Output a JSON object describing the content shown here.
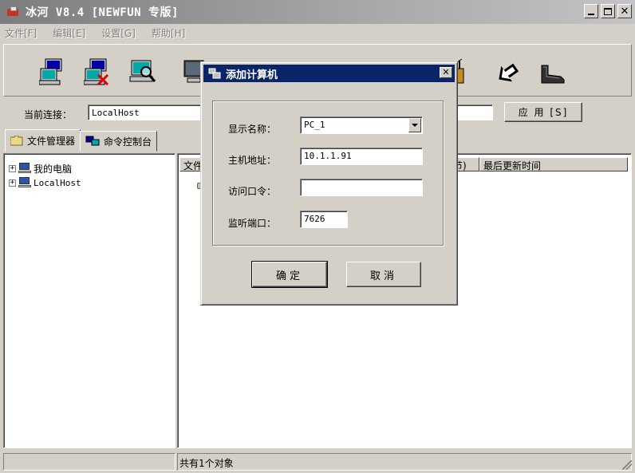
{
  "window": {
    "title": "冰河 V8.4 [NEWFUN 专版]"
  },
  "menu": [
    "文件[F]",
    "编辑[E]",
    "设置[G]",
    "帮助[H]"
  ],
  "toolbar": {
    "buttons": [
      "add-computer-icon",
      "delete-computer-icon",
      "search-computer-icon",
      "monitor-icon",
      "config-icon",
      "back-icon",
      "exit-icon"
    ]
  },
  "connection": {
    "label": "当前连接：",
    "value": "LocalHost",
    "apply_label": "应 用 [S]"
  },
  "tabs": [
    "文件管理器",
    "命令控制台"
  ],
  "tree": [
    {
      "label": "我的电脑"
    },
    {
      "label": "LocalHost"
    }
  ],
  "file_list": {
    "columns": [
      "文件",
      "节)",
      "最后更新时间"
    ]
  },
  "status": {
    "left": "",
    "center": "共有1个对象"
  },
  "dialog": {
    "title": "添加计算机",
    "fields": [
      {
        "label": "显示名称：",
        "value": "PC_1"
      },
      {
        "label": "主机地址：",
        "value": "10.1.1.91"
      },
      {
        "label": "访问口令：",
        "value": ""
      },
      {
        "label": "监听端口：",
        "value": "7626"
      }
    ],
    "ok_label": "确定",
    "cancel_label": "取消"
  }
}
